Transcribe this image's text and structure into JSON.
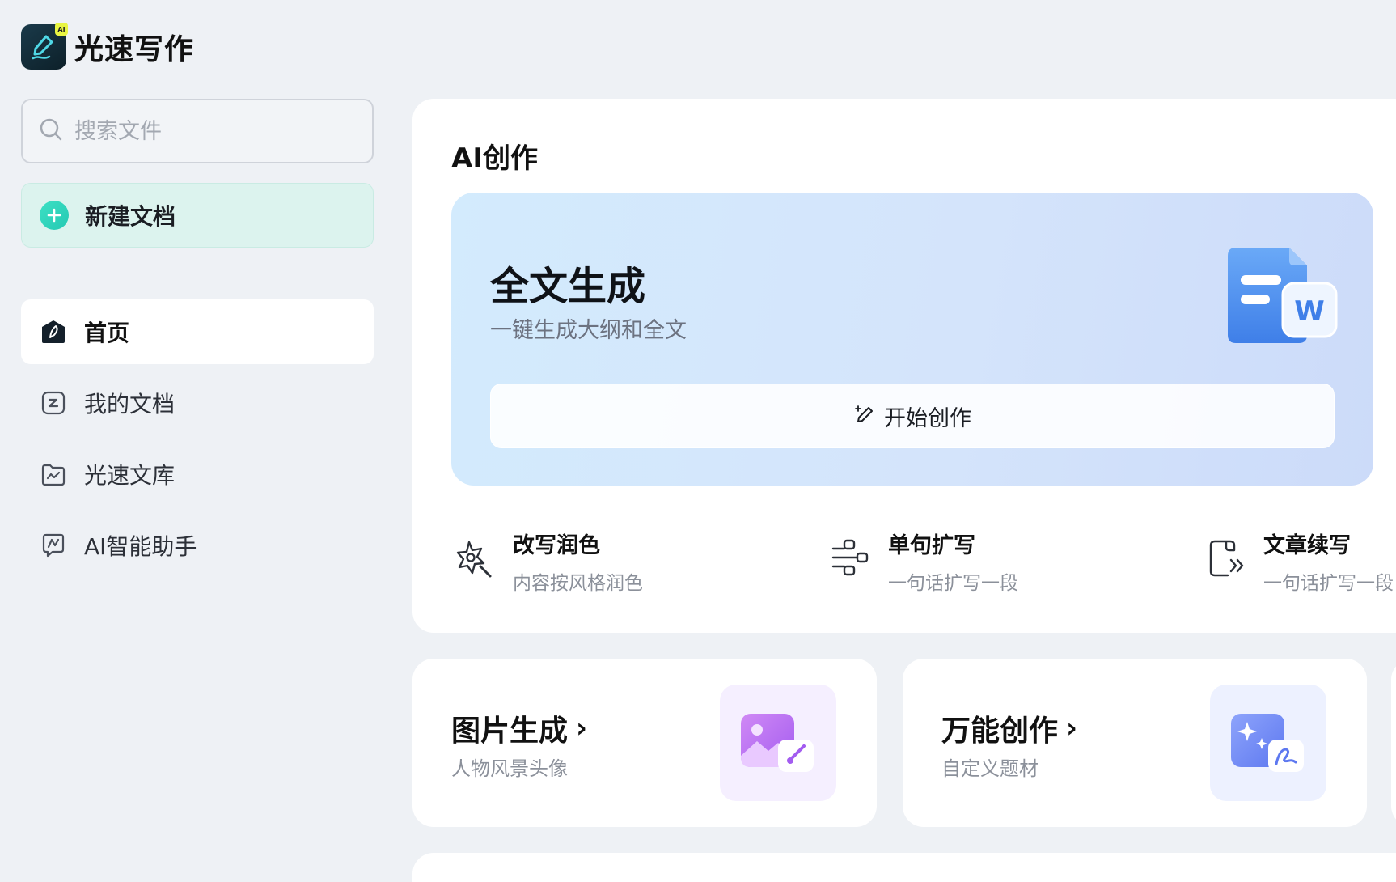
{
  "app": {
    "name": "光速写作",
    "badge": "AI"
  },
  "search": {
    "placeholder": "搜索文件"
  },
  "new_doc": {
    "label": "新建文档"
  },
  "nav": {
    "items": [
      {
        "label": "首页",
        "icon": "home-icon",
        "active": true
      },
      {
        "label": "我的文档",
        "icon": "document-icon",
        "active": false
      },
      {
        "label": "光速文库",
        "icon": "folder-library-icon",
        "active": false
      },
      {
        "label": "AI智能助手",
        "icon": "ai-chat-icon",
        "active": false
      }
    ]
  },
  "ai_section": {
    "title": "AI创作",
    "hero": {
      "title": "全文生成",
      "subtitle": "一键生成大纲和全文",
      "button_label": "开始创作",
      "icon": "word-document-icon",
      "badge_letter": "W"
    },
    "tools": [
      {
        "title": "改写润色",
        "subtitle": "内容按风格润色",
        "icon": "magic-wand-icon"
      },
      {
        "title": "单句扩写",
        "subtitle": "一句话扩写一段",
        "icon": "expand-flow-icon"
      },
      {
        "title": "文章续写",
        "subtitle": "一句话扩写一段",
        "icon": "continue-write-icon"
      }
    ]
  },
  "cards": [
    {
      "title": "图片生成",
      "subtitle": "人物风景头像",
      "icon": "image-brush-icon",
      "chevron": "›"
    },
    {
      "title": "万能创作",
      "subtitle": "自定义题材",
      "icon": "sparkle-pen-icon",
      "chevron": "›"
    }
  ],
  "colors": {
    "background": "#eef1f5",
    "accent_teal": "#2fd3bb",
    "hero_gradient_start": "#d3ebfd",
    "hero_gradient_end": "#ccdbf9",
    "word_blue": "#4e8ef0",
    "image_purple": "#b86ef0"
  }
}
